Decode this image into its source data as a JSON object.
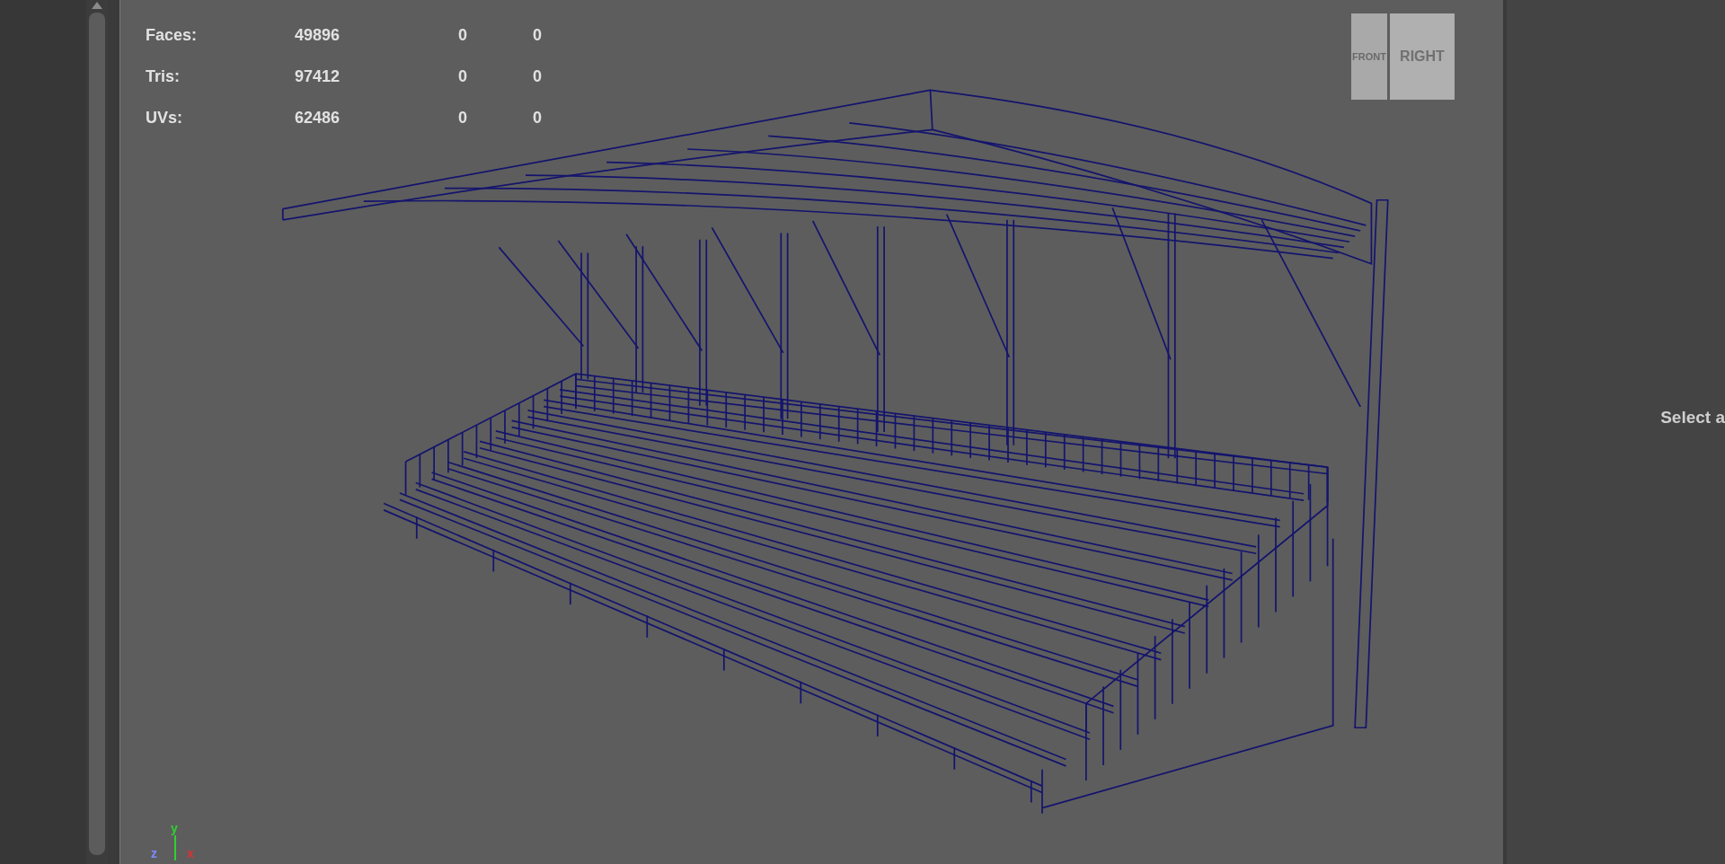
{
  "stats": [
    {
      "label": "Faces:",
      "value": "49896",
      "column_3": "0",
      "column_4": "0"
    },
    {
      "label": "Tris:",
      "value": "97412",
      "column_3": "0",
      "column_4": "0"
    },
    {
      "label": "UVs:",
      "value": "62486",
      "column_3": "0",
      "column_4": "0"
    }
  ],
  "view_cube": {
    "left_face": "FRONT",
    "right_face": "RIGHT"
  },
  "axis": {
    "y": "y",
    "z": "z",
    "x": "x"
  },
  "side_panel": {
    "text": "Select a"
  }
}
